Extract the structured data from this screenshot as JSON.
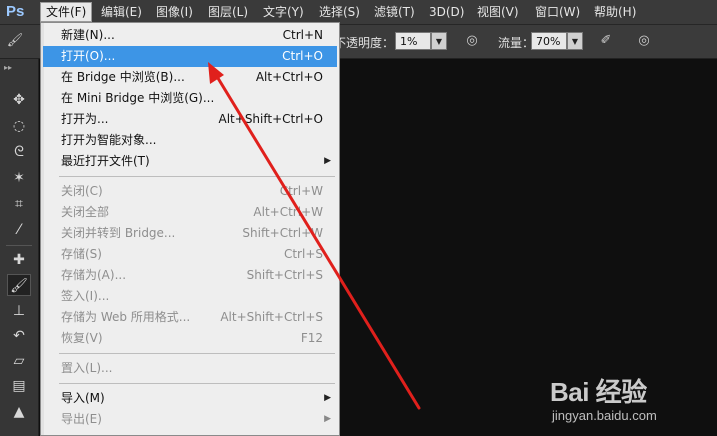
{
  "app": {
    "logo": "Ps"
  },
  "menubar": {
    "items": [
      {
        "label": "文件(F)",
        "active": true
      },
      {
        "label": "编辑(E)"
      },
      {
        "label": "图像(I)"
      },
      {
        "label": "图层(L)"
      },
      {
        "label": "文字(Y)"
      },
      {
        "label": "选择(S)"
      },
      {
        "label": "滤镜(T)"
      },
      {
        "label": "3D(D)"
      },
      {
        "label": "视图(V)"
      },
      {
        "label": "窗口(W)"
      },
      {
        "label": "帮助(H)"
      }
    ]
  },
  "options": {
    "opacity_label": "不透明度：",
    "opacity_value": "1%",
    "flow_label": "流量：",
    "flow_value": "70%"
  },
  "file_menu": {
    "items": [
      {
        "label": "新建(N)...",
        "shortcut": "Ctrl+N"
      },
      {
        "label": "打开(O)...",
        "shortcut": "Ctrl+O",
        "highlight": true
      },
      {
        "label": "在 Bridge 中浏览(B)...",
        "shortcut": "Alt+Ctrl+O"
      },
      {
        "label": "在 Mini Bridge 中浏览(G)..."
      },
      {
        "label": "打开为...",
        "shortcut": "Alt+Shift+Ctrl+O"
      },
      {
        "label": "打开为智能对象..."
      },
      {
        "label": "最近打开文件(T)",
        "submenu": true
      },
      {
        "label": "关闭(C)",
        "shortcut": "Ctrl+W",
        "disabled": true
      },
      {
        "label": "关闭全部",
        "shortcut": "Alt+Ctrl+W",
        "disabled": true
      },
      {
        "label": "关闭并转到 Bridge...",
        "shortcut": "Shift+Ctrl+W",
        "disabled": true
      },
      {
        "label": "存储(S)",
        "shortcut": "Ctrl+S",
        "disabled": true
      },
      {
        "label": "存储为(A)...",
        "shortcut": "Shift+Ctrl+S",
        "disabled": true
      },
      {
        "label": "签入(I)...",
        "disabled": true
      },
      {
        "label": "存储为 Web 所用格式...",
        "shortcut": "Alt+Shift+Ctrl+S",
        "disabled": true
      },
      {
        "label": "恢复(V)",
        "shortcut": "F12",
        "disabled": true
      },
      {
        "label": "置入(L)...",
        "disabled": true
      },
      {
        "label": "导入(M)",
        "submenu": true
      },
      {
        "label": "导出(E)",
        "submenu": true,
        "disabled": true
      }
    ]
  },
  "watermark": {
    "text": "Bai 经验",
    "url": "jingyan.baidu.com"
  },
  "colors": {
    "highlight": "#3d95e6",
    "arrow": "#e0201c",
    "menu_bg": "#eeeeee"
  }
}
